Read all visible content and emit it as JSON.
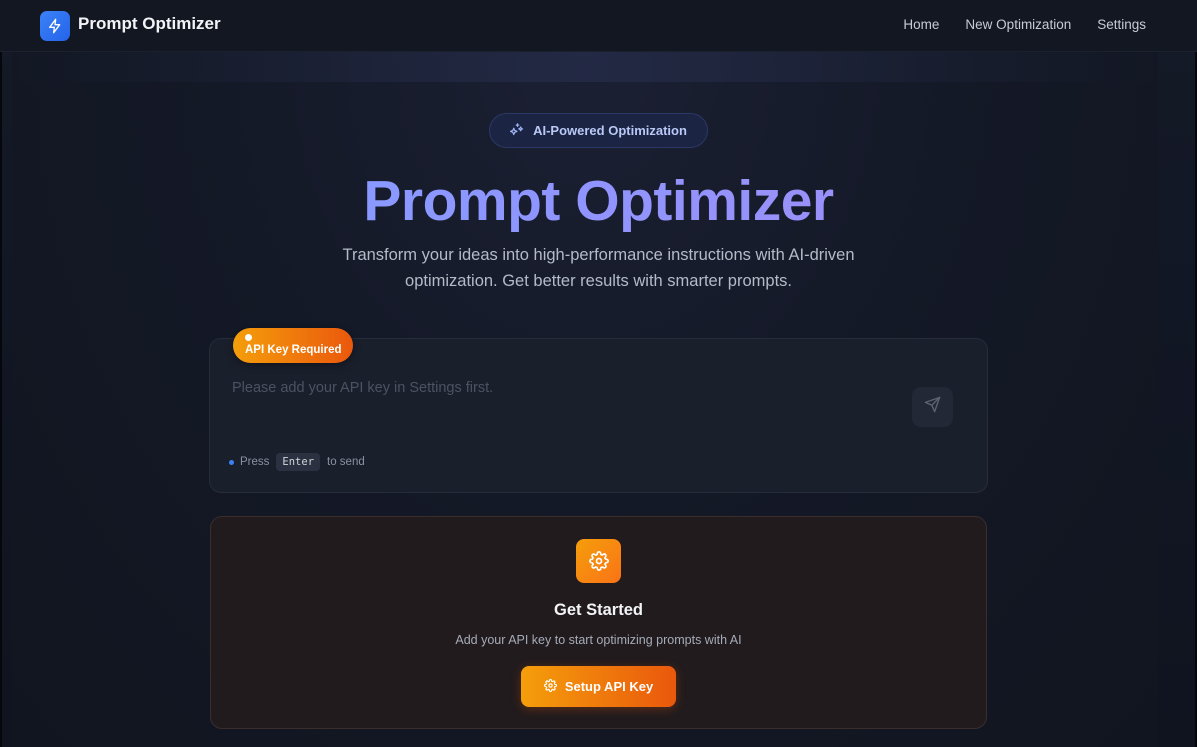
{
  "colors": {
    "brand": "#3b82f6",
    "accent_orange": "#f59e0b",
    "accent_orange_dark": "#ea580c",
    "title_gradient_start": "#7ca2ff",
    "title_gradient_end": "#a58bf2"
  },
  "header": {
    "logo_icon": "lightning-icon",
    "app_name": "Prompt Optimizer",
    "nav": [
      {
        "label": "Home"
      },
      {
        "label": "New Optimization"
      },
      {
        "label": "Settings"
      }
    ]
  },
  "hero": {
    "badge_icon": "sparkles-icon",
    "badge_label": "AI-Powered Optimization",
    "title": "Prompt Optimizer",
    "subtitle": "Transform your ideas into high-performance instructions with AI-driven optimization. Get better results with smarter prompts."
  },
  "composer": {
    "warning_label": "API Key Required",
    "placeholder": "Please add your API key in Settings first.",
    "value": "",
    "send_icon": "send-icon",
    "hint_prefix": "Press",
    "hint_key": "Enter",
    "hint_suffix": "to send"
  },
  "get_started": {
    "icon": "gear-icon",
    "title": "Get Started",
    "description": "Add your API key to start optimizing prompts with AI",
    "button_icon": "gear-icon",
    "button_label": "Setup API Key"
  }
}
